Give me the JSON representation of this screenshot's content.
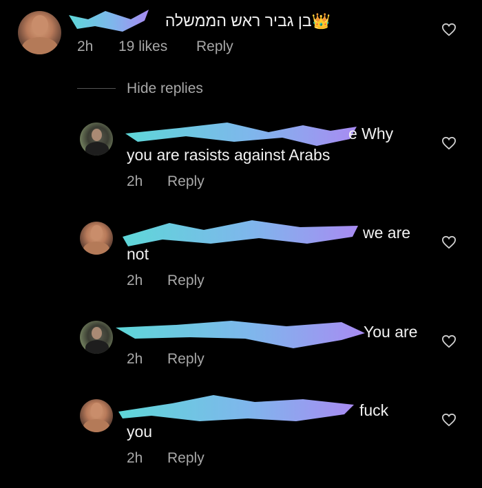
{
  "top_comment": {
    "text": "בן גביר ראש הממשלה",
    "crown_emoji": "👑",
    "time": "2h",
    "likes": "19 likes",
    "reply_label": "Reply"
  },
  "thread": {
    "hide_replies_label": "Hide replies"
  },
  "replies": [
    {
      "avatar": "hood-user-avatar",
      "text_line1": "e Why",
      "text_line2": "you are rasists against Arabs",
      "time": "2h",
      "reply_label": "Reply"
    },
    {
      "avatar": "user-avatar",
      "text_line1": "we are",
      "text_line2": "not",
      "time": "2h",
      "reply_label": "Reply"
    },
    {
      "avatar": "hood-user-avatar",
      "text_line1": "You are",
      "time": "2h",
      "reply_label": "Reply"
    },
    {
      "avatar": "user-avatar",
      "text_line1": "fuck",
      "text_line2": "you",
      "time": "2h",
      "reply_label": "Reply"
    }
  ],
  "icons": {
    "like": "heart-outline-icon"
  },
  "colors": {
    "background": "#000000",
    "text": "#f2f2f2",
    "meta": "#a8a8a8",
    "redaction_blue": "#66d2dc",
    "redaction_purple": "#9f8cf0"
  }
}
